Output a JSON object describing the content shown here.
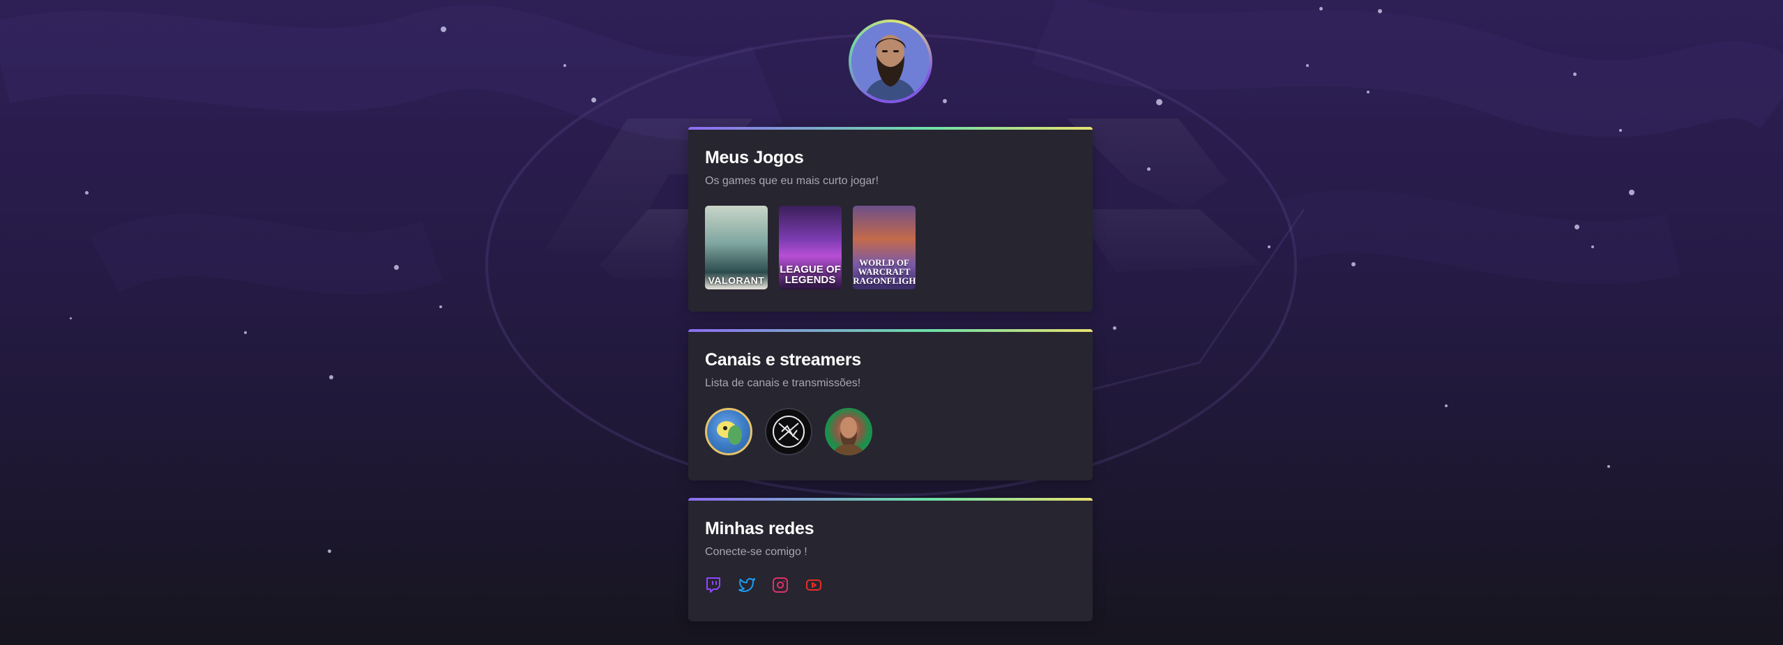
{
  "profile": {
    "avatar": "profile-avatar"
  },
  "games_card": {
    "title": "Meus Jogos",
    "subtitle": "Os games que eu mais curto jogar!",
    "games": [
      {
        "name": "VALORANT"
      },
      {
        "name": "LEAGUE OF LEGENDS"
      },
      {
        "name": "WORLD OF WARCRAFT DRAGONFLIGHT"
      }
    ]
  },
  "channels_card": {
    "title": "Canais e streamers",
    "subtitle": "Lista de canais e transmissões!",
    "channels": [
      "channel-avatar-1",
      "channel-avatar-2",
      "channel-avatar-3"
    ]
  },
  "socials_card": {
    "title": "Minhas redes",
    "subtitle": "Conecte-se comigo !",
    "links": [
      {
        "icon": "twitch-icon",
        "color": "#9146ff"
      },
      {
        "icon": "twitter-icon",
        "color": "#1d9bf0"
      },
      {
        "icon": "instagram-icon",
        "color": "#e1306c"
      },
      {
        "icon": "youtube-icon",
        "color": "#e52d27"
      }
    ]
  },
  "colors": {
    "card_bg": "#27252f",
    "accent_gradient": [
      "#8c6cf2",
      "#6ee0a8",
      "#e8e070"
    ],
    "title": "#ffffff",
    "subtitle": "#a8a8b3"
  }
}
